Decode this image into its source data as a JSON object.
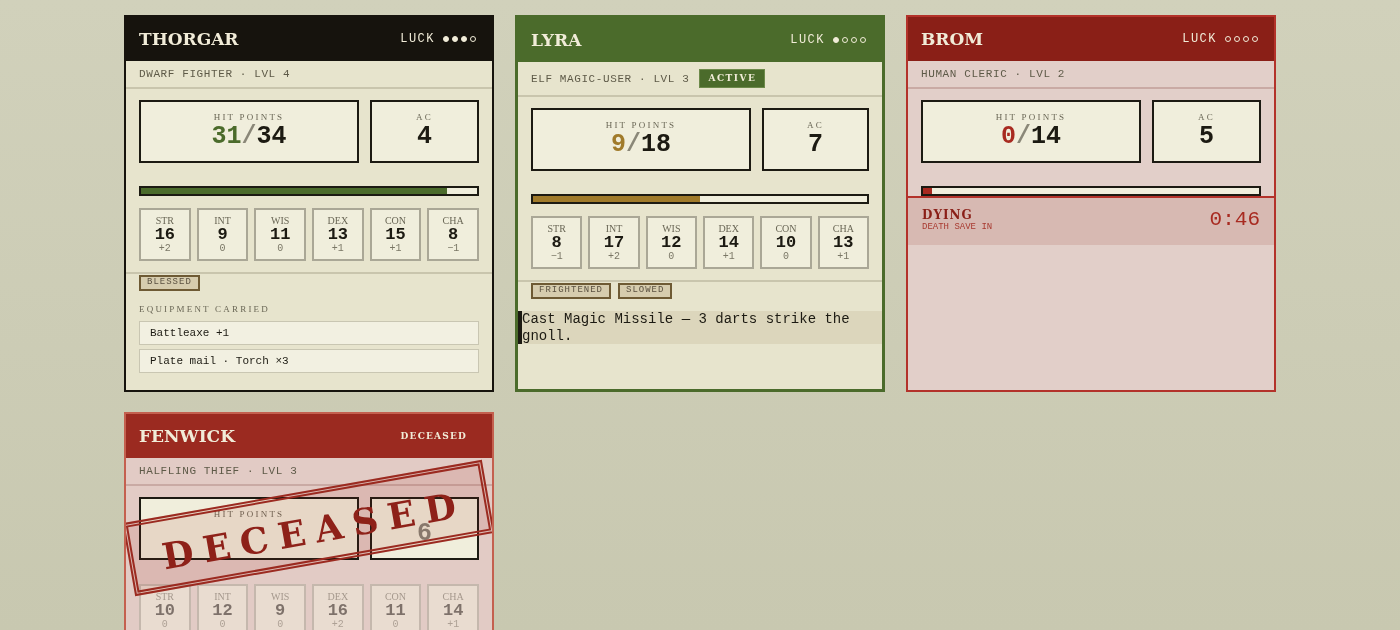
{
  "cards": [
    {
      "kind": "alive",
      "selected": false,
      "name": "THORGAR",
      "luck": {
        "label": "LUCK",
        "stars": 3
      },
      "subtitle": "DWARF FIGHTER · LVL 4",
      "hp": {
        "label": "HIT POINTS",
        "current": "31",
        "divider": "/",
        "max": "34",
        "level": 0.91
      },
      "ac": {
        "label": "AC",
        "value": "4"
      },
      "stats": [
        {
          "label": "STR",
          "value": "16",
          "mod": "+2"
        },
        {
          "label": "INT",
          "value": "9",
          "mod": "0"
        },
        {
          "label": "WIS",
          "value": "11",
          "mod": "0"
        },
        {
          "label": "DEX",
          "value": "13",
          "mod": "+1"
        },
        {
          "label": "CON",
          "value": "15",
          "mod": "+1"
        },
        {
          "label": "CHA",
          "value": "8",
          "mod": "−1"
        }
      ],
      "conditions": [
        "BLESSED"
      ],
      "equipment": {
        "label": "EQUIPMENT CARRIED",
        "items": [
          "Battleaxe +1",
          "Plate mail · Torch ×3"
        ]
      }
    },
    {
      "kind": "alive",
      "selected": true,
      "name": "LYRA",
      "luck": {
        "label": "LUCK",
        "stars": 1
      },
      "subtitle": "ELF MAGIC-USER · LVL 3",
      "badge": "ACTIVE",
      "hp": {
        "label": "HIT POINTS",
        "current": "9",
        "divider": "/",
        "max": "18",
        "level": 0.5
      },
      "ac": {
        "label": "AC",
        "value": "7"
      },
      "stats": [
        {
          "label": "STR",
          "value": "8",
          "mod": "−1"
        },
        {
          "label": "INT",
          "value": "17",
          "mod": "+2"
        },
        {
          "label": "WIS",
          "value": "12",
          "mod": "0"
        },
        {
          "label": "DEX",
          "value": "14",
          "mod": "+1"
        },
        {
          "label": "CON",
          "value": "10",
          "mod": "0"
        },
        {
          "label": "CHA",
          "value": "13",
          "mod": "+1"
        }
      ],
      "conditions": [
        "FRIGHTENED",
        "SLOWED"
      ],
      "log": "Cast Magic Missile — 3 darts strike the gnoll."
    },
    {
      "kind": "dying",
      "selected": false,
      "name": "BROM",
      "luck": {
        "label": "LUCK",
        "stars": 0
      },
      "subtitle": "HUMAN CLERIC · LVL 2",
      "hp": {
        "label": "HIT POINTS",
        "current": "0",
        "divider": "/",
        "max": "14",
        "level": 0
      },
      "ac": {
        "label": "AC",
        "value": "5"
      },
      "dying": {
        "title": "DYING",
        "caption": "DEATH SAVE IN",
        "timer": "0:46"
      }
    },
    {
      "kind": "deceased",
      "selected": false,
      "name": "FENWICK",
      "status": "DECEASED",
      "subtitle": "HALFLING THIEF · LVL 3",
      "hp": {
        "label": "HIT POINTS"
      },
      "ac": {
        "value": "6"
      },
      "stats": [
        {
          "label": "STR",
          "value": "10",
          "mod": "0"
        },
        {
          "label": "INT",
          "value": "12",
          "mod": "0"
        },
        {
          "label": "WIS",
          "value": "9",
          "mod": "0"
        },
        {
          "label": "DEX",
          "value": "16",
          "mod": "+2"
        },
        {
          "label": "CON",
          "value": "11",
          "mod": "0"
        },
        {
          "label": "CHA",
          "value": "14",
          "mod": "+1"
        }
      ],
      "stamp": "DECEASED"
    }
  ]
}
